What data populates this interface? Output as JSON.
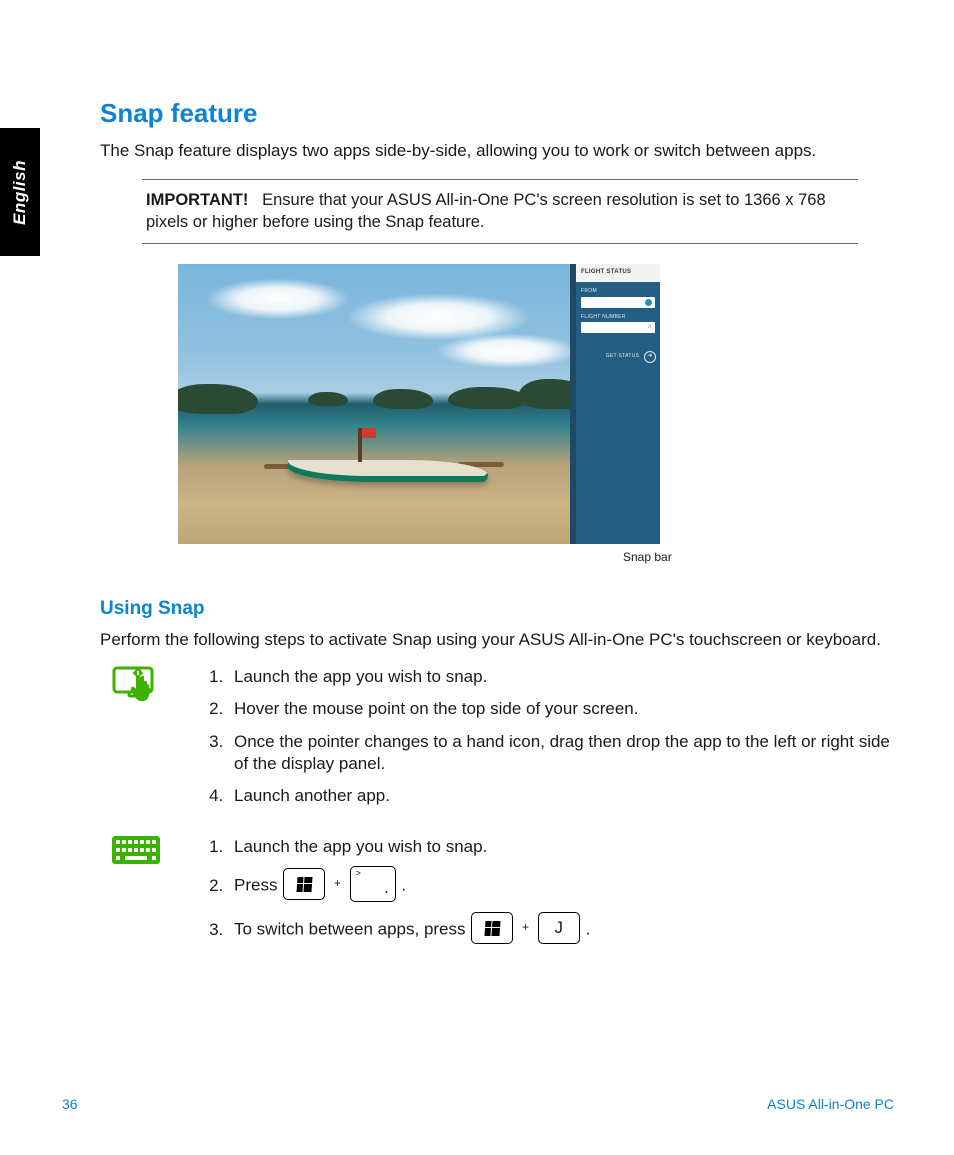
{
  "sideTab": {
    "language": "English"
  },
  "section": {
    "title": "Snap feature",
    "intro": "The Snap feature displays two apps side-by-side, allowing you to work or switch between apps.",
    "noteLabel": "IMPORTANT!",
    "noteBody": "Ensure that your ASUS All-in-One PC's screen resolution is set to 1366 x 768 pixels or higher before using the Snap feature."
  },
  "figure": {
    "caption": "Snap bar",
    "sideApp": {
      "header": "FLIGHT STATUS",
      "fromLabel": "FROM",
      "flightLabel": "FLIGHT NUMBER",
      "button": "GET STATUS"
    }
  },
  "usingSnap": {
    "title": "Using Snap",
    "lead": "Perform the following steps to activate Snap using your ASUS All-in-One PC's touchscreen or keyboard."
  },
  "touchSteps": [
    "Launch the app you wish to snap.",
    "Hover the mouse point on the top side of your screen.",
    "Once the pointer changes to a hand icon, drag then drop the app to the left or right side of the display panel.",
    "Launch another app."
  ],
  "kbSteps": {
    "s1": "Launch the app you wish to snap.",
    "s2_pre": "Press ",
    "s2_post": ".",
    "s3_pre": "To switch between apps, press ",
    "s3_post": ".",
    "keyPeriod": ".",
    "keyPeriodShift": ">",
    "keyJ": "J"
  },
  "footer": {
    "pageNum": "36",
    "product": "ASUS All-in-One PC"
  }
}
